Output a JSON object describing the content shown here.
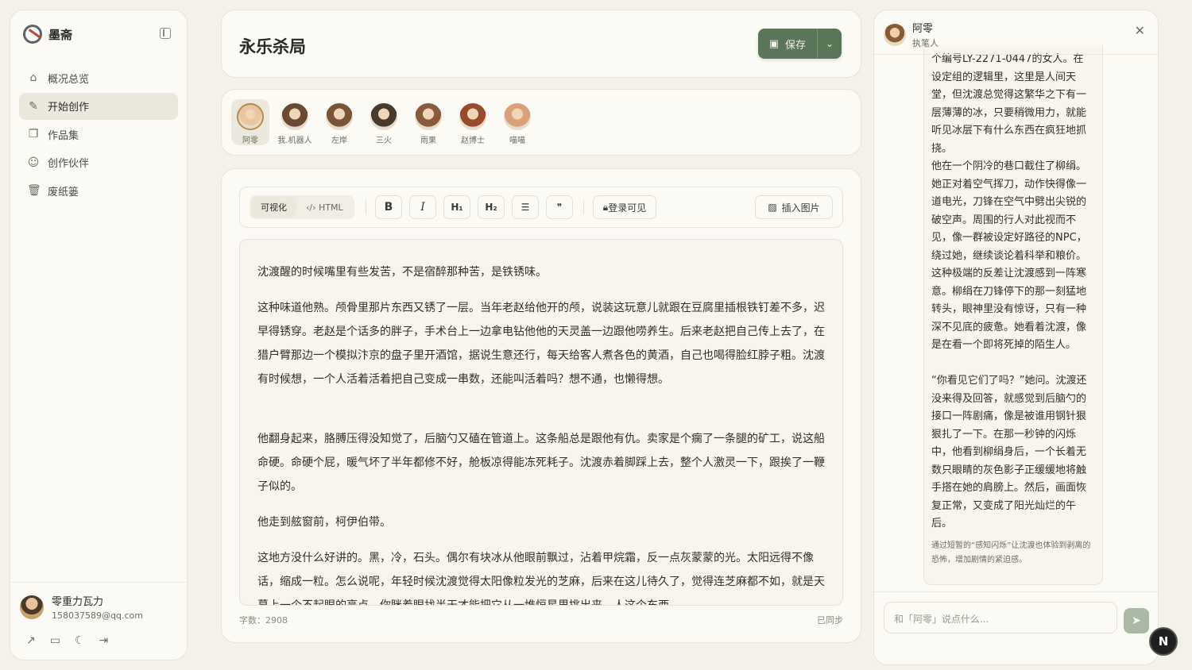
{
  "brand": {
    "name": "墨斋"
  },
  "nav": [
    {
      "label": "概况总览",
      "icon": "home-icon",
      "glyph": "⌂"
    },
    {
      "label": "开始创作",
      "icon": "pen-icon",
      "glyph": "✎",
      "active": true
    },
    {
      "label": "作品集",
      "icon": "copy-icon",
      "glyph": "❐"
    },
    {
      "label": "创作伙伴",
      "icon": "users-icon",
      "glyph": "☺"
    },
    {
      "label": "废纸篓",
      "icon": "trash-icon",
      "glyph": "🗑"
    }
  ],
  "user": {
    "name": "零重力瓦力",
    "email": "158037589@qq.com"
  },
  "doc": {
    "title": "永乐杀局",
    "save_label": "保存"
  },
  "characters": [
    {
      "name": "阿零",
      "active": true,
      "color": "#e9c6a2"
    },
    {
      "name": "我.机器人",
      "color": "#6b4a33"
    },
    {
      "name": "左岸",
      "color": "#7a5438"
    },
    {
      "name": "三火",
      "color": "#4a3a2c"
    },
    {
      "name": "雨果",
      "color": "#8a5a3c"
    },
    {
      "name": "赵博士",
      "color": "#9a4a2c"
    },
    {
      "name": "喵喵",
      "color": "#d9a07a"
    }
  ],
  "toolbar": {
    "mode_visual": "可视化",
    "mode_html": "HTML",
    "bold": "B",
    "italic": "I",
    "h1": "H₁",
    "h2": "H₂",
    "list": "☰",
    "quote": "❞",
    "login_visible": "登录可见",
    "insert_image": "插入图片"
  },
  "editor": {
    "paragraphs": [
      "沈渡醒的时候嘴里有些发苦，不是宿醉那种苦，是铁锈味。",
      "这种味道他熟。颅骨里那片东西又锈了一层。当年老赵给他开的颅，说装这玩意儿就跟在豆腐里插根铁钉差不多，迟早得锈穿。老赵是个话多的胖子，手术台上一边拿电钻他他的天灵盖一边跟他唠养生。后来老赵把自己传上去了，在猎户臂那边一个模拟汴京的盘子里开酒馆，据说生意还行，每天给客人煮各色的黄酒，自己也喝得脸红脖子粗。沈渡有时候想，一个人活着活着把自己变成一串数，还能叫活着吗？想不通，也懒得想。",
      "他翻身起来，胳膊压得没知觉了，后脑勺又磕在管道上。这条船总是跟他有仇。卖家是个瘸了一条腿的矿工，说这船命硬。命硬个屁，暖气坏了半年都修不好，舱板凉得能冻死耗子。沈渡赤着脚踩上去，整个人激灵一下，跟挨了一鞭子似的。",
      "他走到舷窗前，柯伊伯带。",
      "这地方没什么好讲的。黑，冷，石头。偶尔有块冰从他眼前飘过，沾着甲烷霜，反一点灰蒙蒙的光。太阳远得不像话，缩成一粒。怎么说呢，年轻时候沈渡觉得太阳像粒发光的芝麻，后来在这儿待久了，觉得连芝麻都不如，就是天幕上一个不起眼的亮点，你眯着眼找半天才能把它从一堆恒星里挑出来。人这个东西"
    ],
    "word_count": "字数：2908",
    "sync_status": "已同步"
  },
  "chat": {
    "name": "阿零",
    "role": "执笔人",
    "paragraphs": [
      "个编号LY-2271-0447的女人。在设定组的逻辑里，这里是人间天堂，但沈渡总觉得这繁华之下有一层薄薄的冰，只要稍微用力，就能听见冰层下有什么东西在疯狂地抓挠。",
      "他在一个阴冷的巷口截住了柳绢。她正对着空气挥刀，动作快得像一道电光，刀锋在空气中劈出尖锐的破空声。周围的行人对此视而不见，像一群被设定好路径的NPC，绕过她，继续谈论着科举和粮价。这种极端的反差让沈渡感到一阵寒意。柳绢在刀锋停下的那一刻猛地转头，眼神里没有惊讶，只有一种深不见底的疲惫。她看着沈渡，像是在看一个即将死掉的陌生人。",
      "“你看见它们了吗？”她问。沈渡还没来得及回答，就感觉到后脑勺的接口一阵剧痛，像是被谁用钢针狠狠扎了一下。在那一秒钟的闪烁中，他看到柳绢身后，一个长着无数只眼睛的灰色影子正缓缓地将触手搭在她的肩膀上。然后，画面恢复正常，又变成了阳光灿烂的午后。"
    ],
    "note": "通过短暂的“感知闪烁”让沈渡也体验到剥离的恐怖，增加剧情的紧迫感。",
    "input_placeholder": "和「阿零」说点什么..."
  },
  "fab_label": "N",
  "colors": {
    "accent": "#5a7557",
    "background": "#f3f1e9",
    "panel": "#fbfaf5"
  }
}
